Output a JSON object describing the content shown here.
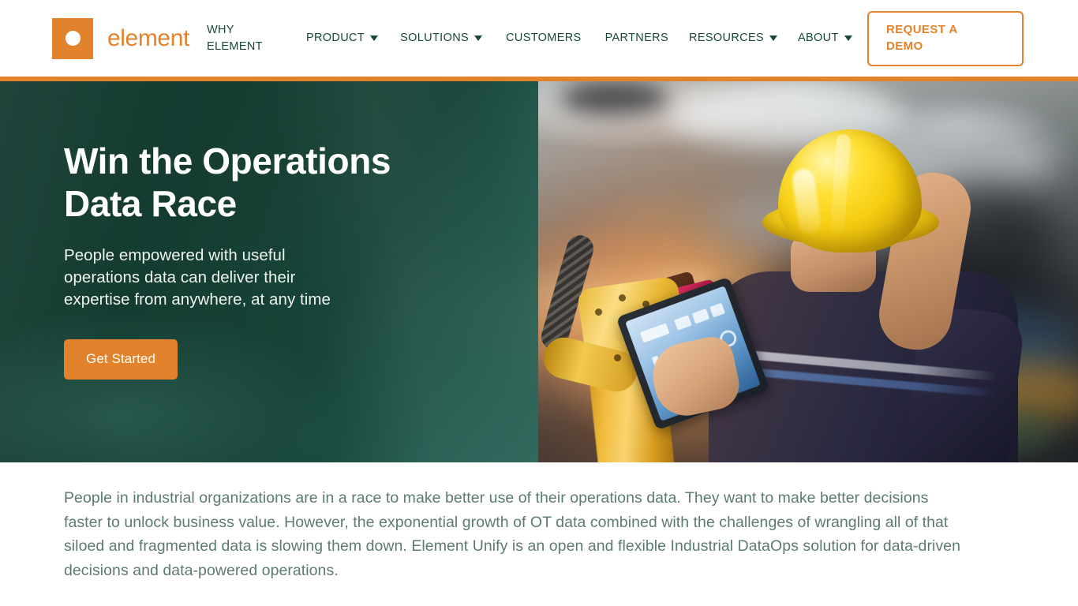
{
  "brand": {
    "wordmark": "element",
    "mark_icon": "element-logo-icon",
    "mark_color": "#e2832c"
  },
  "nav": {
    "items": [
      {
        "label": "WHY\nELEMENT",
        "has_caret": false,
        "stacked": true
      },
      {
        "label": "PRODUCT",
        "has_caret": true,
        "stacked": false
      },
      {
        "label": "SOLUTIONS",
        "has_caret": true,
        "stacked": false
      },
      {
        "label": "CUSTOMERS",
        "has_caret": false,
        "stacked": false
      },
      {
        "label": "PARTNERS",
        "has_caret": false,
        "stacked": false
      },
      {
        "label": "RESOURCES",
        "has_caret": true,
        "stacked": false
      },
      {
        "label": "ABOUT",
        "has_caret": true,
        "stacked": false
      }
    ],
    "text_color": "#18473c",
    "cta": {
      "label": "REQUEST A DEMO",
      "color": "#e2832c"
    }
  },
  "hero": {
    "title": "Win the Operations\nData Race",
    "subtitle": "People empowered with useful\noperations data can deliver their\nexpertise from anywhere, at any time",
    "button_label": "Get Started",
    "button_color": "#e2832c",
    "overlay_color": "#10362c",
    "image_alt": "industrial-worker-with-hardhat-and-tablet-beside-robot-arm"
  },
  "intro": {
    "paragraph": "People in industrial organizations are in a race to make better use of their operations data. They want to make better decisions faster to unlock business value. However, the exponential growth of OT data combined with the challenges of wrangling all of that siloed and fragmented data is slowing them down. Element Unify is an open and flexible Industrial DataOps solution for data-driven decisions and data-powered operations.",
    "text_color": "#5d7a74"
  }
}
